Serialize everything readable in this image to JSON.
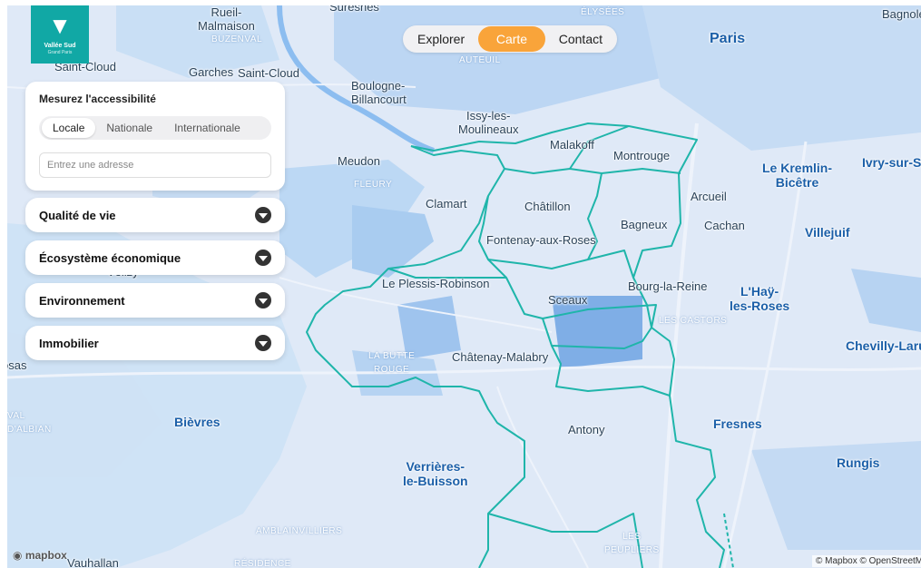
{
  "logo": {
    "name": "Vallée Sud",
    "tagline": "Grand Paris"
  },
  "nav": {
    "tabs": [
      "Explorer",
      "Carte",
      "Contact"
    ],
    "active_index": 1,
    "active_color": "#f9a43a"
  },
  "accessibility": {
    "title": "Mesurez l'accessibilité",
    "scopes": [
      "Locale",
      "Nationale",
      "Internationale"
    ],
    "selected_scope": "Locale",
    "address_placeholder": "Entrez une adresse",
    "address_value": ""
  },
  "sections": [
    {
      "label": "Qualité de vie",
      "icon": "chevron-down-icon"
    },
    {
      "label": "Écosystème économique",
      "icon": "chevron-down-icon"
    },
    {
      "label": "Environnement",
      "icon": "chevron-down-icon"
    },
    {
      "label": "Immobilier",
      "icon": "chevron-down-icon"
    }
  ],
  "map": {
    "boundary_color": "#1fb5aa",
    "labels": {
      "suresnes": "Suresnes",
      "rueil_malmaison": "Rueil-\nMalmaison",
      "buzenval": "BUZENVAL",
      "saint_cloud_a": "Saint-Cloud",
      "garches": "Garches",
      "saint_cloud_b": "Saint-Cloud",
      "boulogne": "Boulogne-\nBillancourt",
      "issy": "Issy-les-\nMoulineaux",
      "paris": "Paris",
      "malakoff": "Malakoff",
      "montrouge": "Montrouge",
      "meudon": "Meudon",
      "clamart": "Clamart",
      "chatillon": "Châtillon",
      "bagneux": "Bagneux",
      "fontenay": "Fontenay-aux-Roses",
      "arcueil": "Arcueil",
      "cachan": "Cachan",
      "kremlin": "Le Kremlin-\nBicêtre",
      "ivry": "Ivry-sur-Se",
      "villejuif": "Villejuif",
      "plessis": "Le Plessis-Robinson",
      "sceaux": "Sceaux",
      "bourg_la_reine": "Bourg-la-Reine",
      "lhay": "L'Haÿ-\nles-Roses",
      "chatenay": "Châtenay-Malabry",
      "la_butte_rouge": "LA BUTTE\nROUGE",
      "chevilly": "Chevilly-Laru",
      "les_castors": "LES CASTORS",
      "bievres": "Bièvres",
      "antony": "Antony",
      "fresnes": "Fresnes",
      "rungis": "Rungis",
      "verrieres": "Verrières-\nle-Buisson",
      "val_albian": "VAL\nD'ALBIAN",
      "amblainvilliers": "AMBLAINVILLIERS",
      "les_peupliers": "LES\nPEUPLIERS",
      "vauhallan": "Vauhallan",
      "residence": "RÉSIDENCE",
      "velizy": "Vélizy-",
      "bagnolet": "Bagnole",
      "elysees": "ÉLYSÉES",
      "auteuil": "AUTEUIL",
      "fleury": "FLEURY",
      "rosas": "osas"
    }
  },
  "attribution": {
    "mapbox": "mapbox",
    "credits": "© Mapbox © OpenStreetMap"
  }
}
